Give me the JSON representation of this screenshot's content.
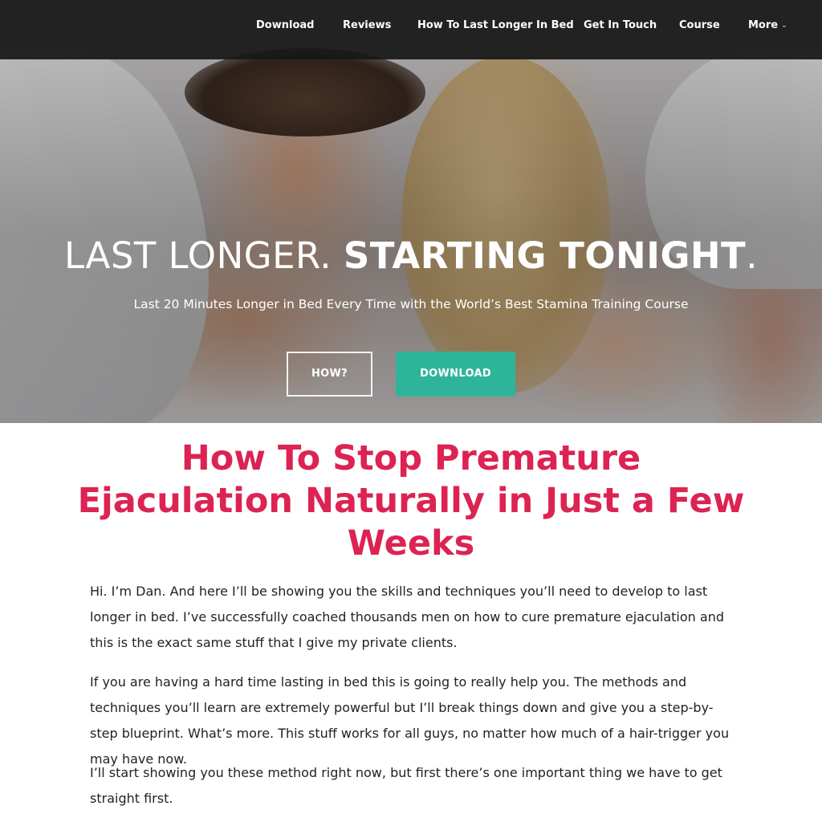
{
  "nav": {
    "items": [
      "Download",
      "Reviews",
      "How To Last Longer In Bed",
      "Get In Touch",
      "Course",
      "More"
    ],
    "more_chevron": "chevron-down-icon"
  },
  "hero": {
    "title_light": "LAST LONGER. ",
    "title_bold": "STARTING TONIGHT",
    "title_end": ".",
    "subtitle": "Last 20 Minutes Longer in Bed Every Time with the World’s Best Stamina Training Course",
    "buttons": {
      "how": "HOW?",
      "download": "DOWNLOAD"
    }
  },
  "article": {
    "title": "How To Stop Premature Ejaculation Naturally in Just a Few Weeks",
    "paragraphs": [
      "Hi. I’m Dan. And here I’ll be showing you the skills and techniques you’ll need to develop to last longer in bed. I’ve successfully coached thousands men on how to cure premature ejaculation and this is the exact same stuff that I give my private clients.",
      "If you are having a hard time lasting in bed this is going to really help you. The methods and techniques you’ll learn are extremely powerful but I’ll break things down and give you a step-by-step blueprint. What’s more. This stuff works for all guys, no matter how much of a hair-trigger you may have now.",
      "I’ll start showing you these method right now, but first there’s one important thing we have to get straight first."
    ]
  },
  "colors": {
    "accent_title": "#dc2352",
    "download_button": "#2fb49c",
    "nav_background": "#181818"
  }
}
